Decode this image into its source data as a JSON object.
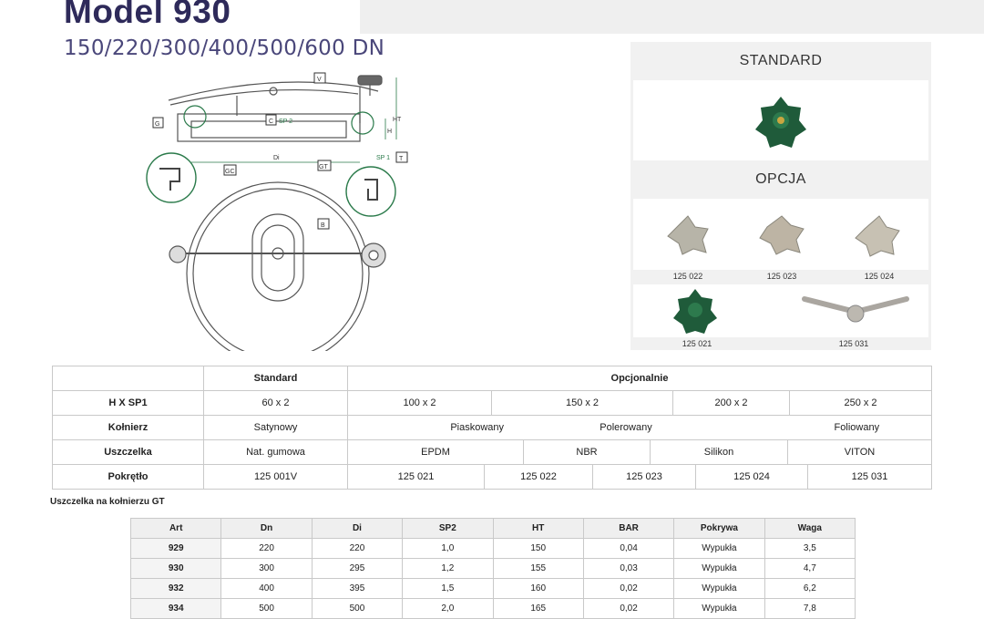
{
  "header": {
    "title": "Model 930",
    "subtitle": "150/220/300/400/500/600 DN"
  },
  "drawing": {
    "labels": {
      "v": "V",
      "c": "C",
      "sp2": "SP 2",
      "ht": "HT",
      "h": "H",
      "g": "G",
      "di": "Di",
      "sp1": "SP 1",
      "t": "T",
      "gc": "GC",
      "gt": "GT",
      "b": "B"
    }
  },
  "knobs": {
    "standard_header": "STANDARD",
    "option_header": "OPCJA",
    "items": [
      {
        "code": "125 022"
      },
      {
        "code": "125 023"
      },
      {
        "code": "125 024"
      },
      {
        "code": "125 021"
      },
      {
        "code": "125 031"
      }
    ],
    "colors": {
      "green": "#1f5b3a",
      "steel": "#b7b4a8"
    }
  },
  "spec_table": {
    "col_standard": "Standard",
    "col_optional": "Opcjonalnie",
    "rows": {
      "hxsp1": {
        "label": "H X SP1",
        "standard": "60 x 2",
        "options": [
          "100 x 2",
          "150 x 2",
          "200 x 2",
          "250 x 2"
        ]
      },
      "kolnierz": {
        "label": "Kołnierz",
        "standard": "Satynowy",
        "options": [
          "Piaskowany",
          "Polerowany",
          "Foliowany"
        ]
      },
      "uszczelka": {
        "label": "Uszczelka",
        "standard": "Nat. gumowa",
        "options": [
          "EPDM",
          "NBR",
          "Silikon",
          "VITON"
        ]
      },
      "pokretlo": {
        "label": "Pokrętło",
        "standard": "125 001V",
        "options": [
          "125 021",
          "125 022",
          "125 023",
          "125 024",
          "125 031"
        ]
      }
    }
  },
  "seal_note": "Uszczelka na kołnierzu GT",
  "art_table": {
    "headers": [
      "Art",
      "Dn",
      "Di",
      "SP2",
      "HT",
      "BAR",
      "Pokrywa",
      "Waga"
    ],
    "rows": [
      [
        "929",
        "220",
        "220",
        "1,0",
        "150",
        "0,04",
        "Wypukła",
        "3,5"
      ],
      [
        "930",
        "300",
        "295",
        "1,2",
        "155",
        "0,03",
        "Wypukła",
        "4,7"
      ],
      [
        "932",
        "400",
        "395",
        "1,5",
        "160",
        "0,02",
        "Wypukła",
        "6,2"
      ],
      [
        "934",
        "500",
        "500",
        "2,0",
        "165",
        "0,02",
        "Wypukła",
        "7,8"
      ]
    ]
  }
}
